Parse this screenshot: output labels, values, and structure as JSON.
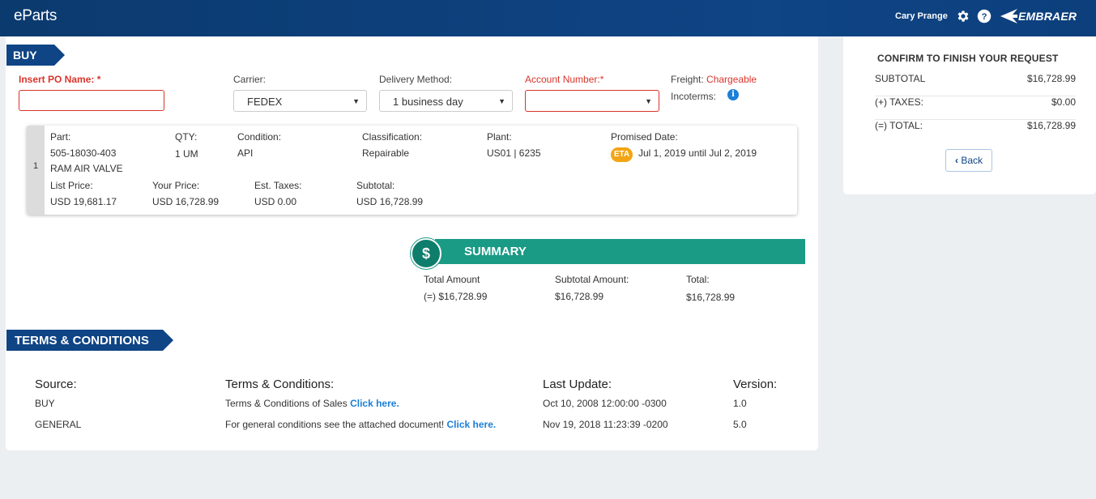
{
  "header": {
    "brand": "eParts",
    "user": "Cary Prange",
    "logo_text": "EMBRAER",
    "icons": [
      "gear-icon",
      "help-icon",
      "embraer-logo-icon"
    ],
    "color": "#0f4485"
  },
  "buy": {
    "flag": "BUY",
    "po_label": "Insert PO Name: *",
    "po_value": "",
    "carrier_label": "Carrier:",
    "carrier_value": "FEDEX",
    "delivery_label": "Delivery Method:",
    "delivery_value": "1 business day",
    "account_label": "Account Number:*",
    "account_value": "",
    "freight_label": "Freight:",
    "freight_value": "Chargeable",
    "incoterms_label": "Incoterms:"
  },
  "item": {
    "index": "1",
    "part_label": "Part:",
    "part_number": "505-18030-403",
    "part_name": "RAM AIR VALVE",
    "qty_label": "QTY:",
    "qty_value": "1 UM",
    "condition_label": "Condition:",
    "condition_value": "API",
    "classification_label": "Classification:",
    "classification_value": "Repairable",
    "plant_label": "Plant:",
    "plant_value": "US01 | 6235",
    "promised_label": "Promised Date:",
    "eta_badge": "ETA",
    "promised_value": "Jul 1, 2019 until Jul 2, 2019",
    "list_price_label": "List Price:",
    "list_price_value": "USD 19,681.17",
    "your_price_label": "Your Price:",
    "your_price_value": "USD 16,728.99",
    "est_taxes_label": "Est. Taxes:",
    "est_taxes_value": "USD 0.00",
    "subtotal_label": "Subtotal:",
    "subtotal_value": "USD 16,728.99"
  },
  "summary": {
    "title": "SUMMARY",
    "icon": "$",
    "total_amount_label": "Total Amount",
    "total_amount_value": "(=) $16,728.99",
    "subtotal_label": "Subtotal Amount:",
    "subtotal_value": "$16,728.99",
    "total_label": "Total:",
    "total_value": "$16,728.99",
    "color": "#1a9b85"
  },
  "terms": {
    "flag": "TERMS & CONDITIONS",
    "headers": [
      "Source:",
      "Terms & Conditions:",
      "Last Update:",
      "Version:"
    ],
    "rows": [
      {
        "source": "BUY",
        "text": "Terms & Conditions of Sales",
        "link": "Click here.",
        "updated": "Oct 10, 2008 12:00:00 -0300",
        "version": "1.0"
      },
      {
        "source": "GENERAL",
        "text": "For general conditions see the attached document!",
        "link": "Click here.",
        "updated": "Nov 19, 2018 11:23:39 -0200",
        "version": "5.0"
      }
    ]
  },
  "confirm": {
    "title": "CONFIRM TO FINISH YOUR REQUEST",
    "rows": [
      {
        "label": "SUBTOTAL",
        "value": "$16,728.99"
      },
      {
        "label": "(+) TAXES:",
        "value": "$0.00"
      },
      {
        "label": "(=) TOTAL:",
        "value": "$16,728.99"
      }
    ],
    "back_label": "Back"
  }
}
